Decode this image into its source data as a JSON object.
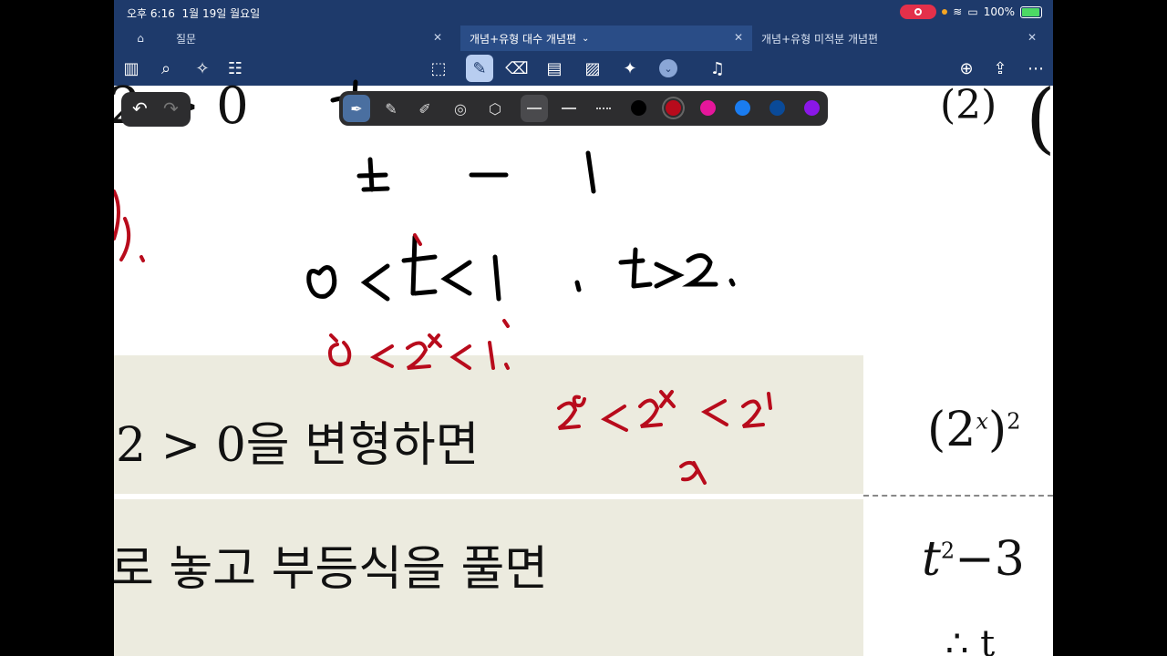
{
  "status_bar": {
    "time": "오후 6:16",
    "date": "1월 19일 월요일",
    "battery": "100%"
  },
  "tabs": [
    {
      "label": "질문",
      "active": false
    },
    {
      "label": "개념+유형 대수 개념편",
      "active": true
    },
    {
      "label": "개념+유형 미적분 개념편",
      "active": false
    }
  ],
  "toolbar": {
    "icons": [
      "sidebar-icon",
      "search-icon",
      "magic-icon",
      "document-icon",
      "lasso-icon",
      "pen-icon",
      "eraser-icon",
      "sticky-note-icon",
      "image-icon",
      "laser-pointer-icon",
      "chevron-down-icon",
      "microphone-icon",
      "add-page-icon",
      "share-icon",
      "more-icon"
    ],
    "selected_tool": "pen"
  },
  "pen_palette": {
    "colors": [
      "#000000",
      "#b80b1c",
      "#e5169b",
      "#1a7cf0",
      "#0a4a98",
      "#8a17e8"
    ],
    "selected_color": "#b80b1c",
    "selected_line": "solid"
  },
  "page": {
    "top_left_fragment": "2 > 0",
    "top_right_label": "(2)",
    "row1_text": "2 > 0을 변형하면",
    "row2_text": "로 놓고 부등식을 풀면",
    "right_col_1": "(2",
    "right_col_1_sup": "x",
    "right_col_1_end": ")",
    "right_col_1_sup2": "2",
    "right_col_2": "t",
    "right_col_2_sup": "2",
    "right_col_2_end": "−3",
    "bottom_right_fragment": "∴ t"
  },
  "handwriting": {
    "line1": "t - 1",
    "line2": "0 < t < 1 , t > 2.",
    "red_line1": "0 < 2ˣ < 1.",
    "red_line2": "2⁰ < 2ˣ < 2¹",
    "red_line3": "x",
    "red_fragment": "0)."
  }
}
